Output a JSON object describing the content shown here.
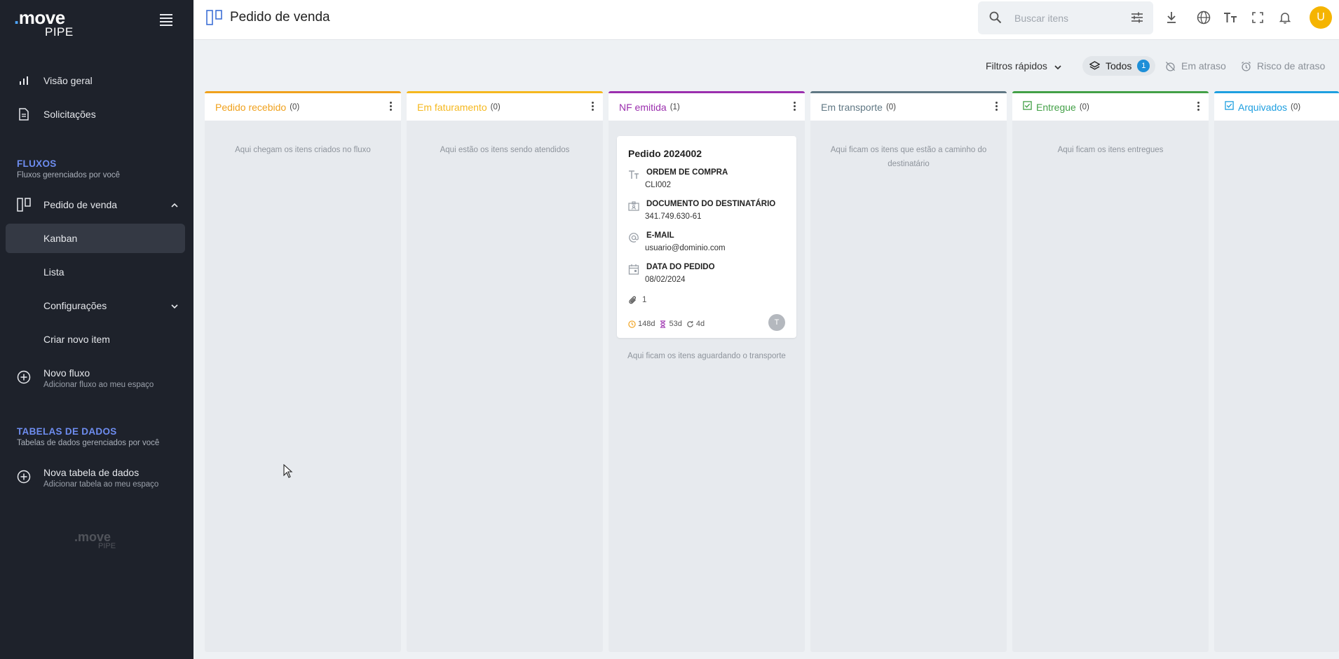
{
  "sidebar": {
    "logo_top": "move",
    "logo_bottom": "PIPE",
    "nav": [
      {
        "label": "Visão geral"
      },
      {
        "label": "Solicitações"
      }
    ],
    "flows_section": {
      "title": "FLUXOS",
      "subtitle": "Fluxos gerenciados por você"
    },
    "flow": {
      "label": "Pedido de venda"
    },
    "flow_items": [
      {
        "label": "Kanban",
        "active": true
      },
      {
        "label": "Lista"
      },
      {
        "label": "Configurações"
      },
      {
        "label": "Criar novo item"
      }
    ],
    "new_flow": {
      "label": "Novo fluxo",
      "subtitle": "Adicionar fluxo ao meu espaço"
    },
    "tables_section": {
      "title": "TABELAS DE DADOS",
      "subtitle": "Tabelas de dados gerenciados por você"
    },
    "new_table": {
      "label": "Nova tabela de dados",
      "subtitle": "Adicionar tabela ao meu espaço"
    },
    "footer_logo_top": "move",
    "footer_logo_bottom": "PIPE"
  },
  "header": {
    "title": "Pedido de venda",
    "search_placeholder": "Buscar itens",
    "avatar_initial": "U"
  },
  "quick_filters": {
    "label": "Filtros rápidos",
    "all": "Todos",
    "all_count": "1",
    "late": "Em atraso",
    "risk": "Risco de atraso"
  },
  "columns": [
    {
      "name": "Pedido recebido",
      "count": "(0)",
      "color": "#f0a11c",
      "empty": "Aqui chegam os itens criados no fluxo"
    },
    {
      "name": "Em faturamento",
      "count": "(0)",
      "color": "#f5b81f",
      "empty": "Aqui estão os itens sendo atendidos"
    },
    {
      "name": "NF emitida",
      "count": "(1)",
      "color": "#9b2fae",
      "empty": "Aqui ficam os itens aguardando o transporte"
    },
    {
      "name": "Em transporte",
      "count": "(0)",
      "color": "#607884",
      "empty": "Aqui ficam os itens que estão a caminho do destinatário"
    },
    {
      "name": "Entregue",
      "count": "(0)",
      "color": "#43a047",
      "empty": "Aqui ficam os itens entregues"
    },
    {
      "name": "Arquivados",
      "count": "(0)",
      "color": "#1e9fe0",
      "empty": ""
    }
  ],
  "card": {
    "title": "Pedido 2024002",
    "fields": [
      {
        "label": "ORDEM DE COMPRA",
        "value": "CLI002",
        "icon": "text-field-icon"
      },
      {
        "label": "DOCUMENTO DO DESTINATÁRIO",
        "value": "341.749.630-61",
        "icon": "id-card-icon"
      },
      {
        "label": "E-MAIL",
        "value": "usuario@dominio.com",
        "icon": "at-sign-icon"
      },
      {
        "label": "DATA DO PEDIDO",
        "value": "08/02/2024",
        "icon": "calendar-icon"
      }
    ],
    "attachments": "1",
    "metrics": {
      "age": "148d",
      "phase": "53d",
      "updated": "4d"
    },
    "assignee_initial": "T"
  }
}
